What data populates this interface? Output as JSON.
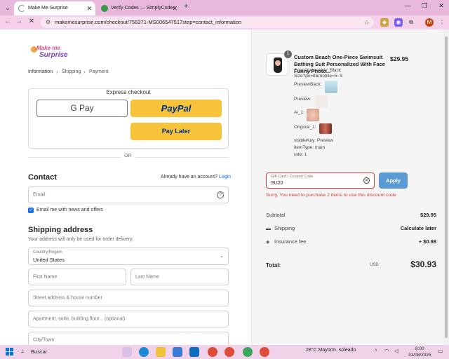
{
  "browser": {
    "tabs": [
      {
        "title": "Make Me Surprise",
        "close": "✕"
      },
      {
        "title": "Verify Codes — SimplyCodes",
        "close": "✕"
      }
    ],
    "new_tab": "+",
    "url": "makemesurprise.com/checkout/756371-MS006547517step=contact_information"
  },
  "checkout": {
    "logo": {
      "line1": "Make me",
      "line2": "Surprise"
    },
    "breadcrumb": [
      "Information",
      "Shipping",
      "Payment"
    ],
    "express_title": "Express checkout",
    "gpay_label": "G Pay",
    "paypal_label": "PayPal",
    "paylater_label": "Pay Later",
    "or": "OR",
    "contact_heading": "Contact",
    "account_prompt": "Already have an account?",
    "login_link": "Login",
    "email_placeholder": "Email",
    "email_news_label": "Email me with news and offers",
    "shipping_heading": "Shipping address",
    "shipping_note": "Your address will only be used for order delivery.",
    "country_label": "Country/Region",
    "country_value": "United States",
    "first_name": "First Name",
    "last_name": "Last Name",
    "street": "Street address & house number",
    "apartment": "Apartment, suite, building floor... (optional)",
    "city": "City/Town"
  },
  "summary": {
    "qty": "1",
    "product_title": "Custom Beach One-Piece Swimsuit Bathing Suit Personalized With Face Funny Photo...",
    "price": "$29.95",
    "meta": [
      "Color?type=hide: Black",
      "Size?pc=8&mobile=5: S",
      "PreviewBack:",
      "Preview:",
      "Ai_1:",
      "Original_1:",
      "visibleKey:  Preview",
      "itemType:  main",
      "rate:  1"
    ],
    "coupon_label": "Gift Card / Coupon Code",
    "coupon_value": "SU20",
    "apply": "Apply",
    "error": "Sorry, You need to purchase 2 items to use this discount code",
    "subtotal_label": "Subtotal",
    "subtotal_value": "$29.95",
    "shipping_label": "Shipping",
    "shipping_value": "Calculate later",
    "insurance_label": "Insurance fee",
    "insurance_value": "+ $0.98",
    "total_label": "Total:",
    "total_currency": "USD",
    "total_value": "$30.93"
  },
  "taskbar": {
    "search": "Buscar",
    "weather": "28°C  Mayorm. soleado",
    "time": "8:00",
    "date": "31/08/2025"
  }
}
